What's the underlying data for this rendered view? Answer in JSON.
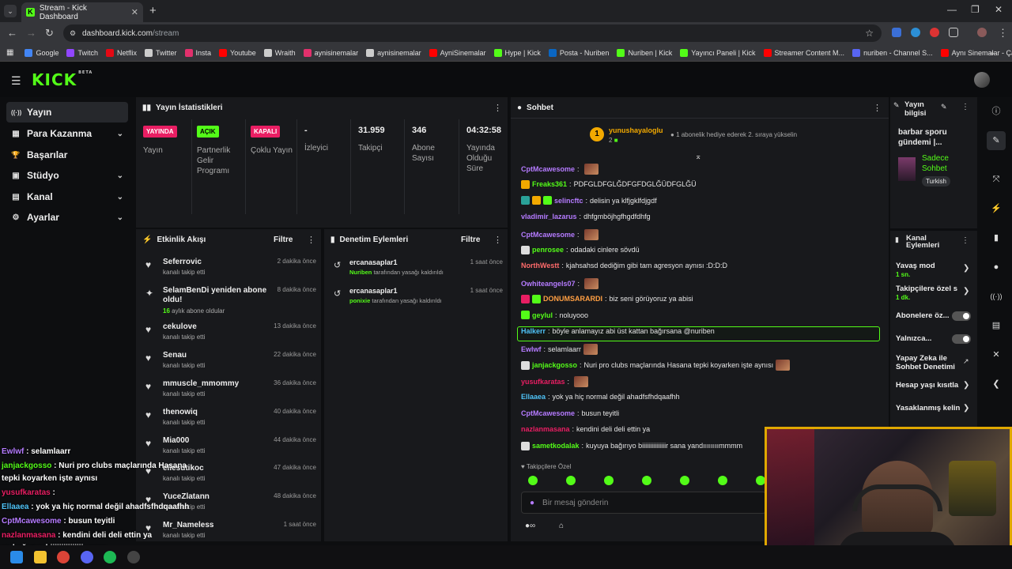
{
  "browser": {
    "tab_title": "Stream - Kick Dashboard",
    "url_host": "dashboard.kick.com",
    "url_path": "/stream",
    "bookmarks": [
      {
        "label": "Google",
        "color": "#4285f4"
      },
      {
        "label": "Twitch",
        "color": "#9146ff"
      },
      {
        "label": "Netflix",
        "color": "#e50914"
      },
      {
        "label": "Twitter",
        "color": "#cccccc"
      },
      {
        "label": "Insta",
        "color": "#e1306c"
      },
      {
        "label": "Youtube",
        "color": "#ff0000"
      },
      {
        "label": "Wraith",
        "color": "#cccccc"
      },
      {
        "label": "aynisinemalar",
        "color": "#e1306c"
      },
      {
        "label": "aynisinemalar",
        "color": "#cccccc"
      },
      {
        "label": "AyniSinemalar",
        "color": "#ff0000"
      },
      {
        "label": "Hype | Kick",
        "color": "#53fc18"
      },
      {
        "label": "Posta - Nuriben",
        "color": "#0a66c2"
      },
      {
        "label": "Nuriben | Kick",
        "color": "#53fc18"
      },
      {
        "label": "Yayıncı Paneli | Kick",
        "color": "#53fc18"
      },
      {
        "label": "Streamer Content M...",
        "color": "#ff0000"
      },
      {
        "label": "nuriben - Channel S...",
        "color": "#5865f2"
      },
      {
        "label": "Aynı Sinemalar - Ça...",
        "color": "#ff0000"
      }
    ],
    "bookmarks_more": "»"
  },
  "header": {
    "logo": "KICK",
    "beta": "BETA"
  },
  "sidebar": {
    "items": [
      {
        "label": "Yayın",
        "icon": "broadcast-icon",
        "glyph": "((·))"
      },
      {
        "label": "Para Kazanma",
        "icon": "money-icon",
        "glyph": "▦",
        "chev": "⌄"
      },
      {
        "label": "Başarılar",
        "icon": "trophy-icon",
        "glyph": "🏆"
      },
      {
        "label": "Stüdyo",
        "icon": "studio-icon",
        "glyph": "▣",
        "chev": "⌄"
      },
      {
        "label": "Kanal",
        "icon": "channel-icon",
        "glyph": "▤",
        "chev": "⌄"
      },
      {
        "label": "Ayarlar",
        "icon": "gear-icon",
        "glyph": "⚙",
        "chev": "⌄"
      }
    ]
  },
  "stats": {
    "title": "Yayın İstatistikleri",
    "items": [
      {
        "badge": "YAYINDA",
        "badge_color": "#e91e63",
        "label": "Yayın"
      },
      {
        "badge": "AÇIK",
        "badge_color": "#53fc18",
        "label": "Partnerlik Gelir Programı"
      },
      {
        "badge": "KAPALI",
        "badge_color": "#e91e63",
        "label": "Çoklu Yayın"
      },
      {
        "value": "-",
        "label": "İzleyici"
      },
      {
        "value": "31.959",
        "label": "Takipçi"
      },
      {
        "value": "346",
        "label": "Abone Sayısı"
      },
      {
        "value": "04:32:58",
        "label": "Yayında Olduğu Süre"
      }
    ]
  },
  "activity": {
    "title": "Etkinlik Akışı",
    "filter": "Filtre",
    "items": [
      {
        "name": "Seferrovic",
        "sub": "kanalı takip etti",
        "time": "2 dakika önce"
      },
      {
        "name": "SelamBenDi yeniden abone oldu!",
        "sub_num": "16",
        "sub": "aylık abone oldular",
        "time": "8 dakika önce"
      },
      {
        "name": "cekulove",
        "sub": "kanalı takip etti",
        "time": "13 dakika önce"
      },
      {
        "name": "Senau",
        "sub": "kanalı takip etti",
        "time": "22 dakika önce"
      },
      {
        "name": "mmuscle_mmommy",
        "sub": "kanalı takip etti",
        "time": "36 dakika önce"
      },
      {
        "name": "thenowiq",
        "sub": "kanalı takip etti",
        "time": "40 dakika önce"
      },
      {
        "name": "Mia000",
        "sub": "kanalı takip etti",
        "time": "44 dakika önce"
      },
      {
        "name": "eliesutikoc",
        "sub": "kanalı takip etti",
        "time": "47 dakika önce"
      },
      {
        "name": "YuceZlatann",
        "sub": "kanalı takip etti",
        "time": "48 dakika önce"
      },
      {
        "name": "Mr_Nameless",
        "sub": "kanalı takip etti",
        "time": "1 saat önce"
      }
    ]
  },
  "moderation": {
    "title": "Denetim Eylemleri",
    "filter": "Filtre",
    "items": [
      {
        "name": "ercanasaplar1",
        "target": "Nuriben",
        "sub": "tarafından yasağı kaldırıldı",
        "time": "1 saat önce"
      },
      {
        "name": "ercanasaplar1",
        "target": "ponixie",
        "sub": "tarafından yasağı kaldırıldı",
        "time": "1 saat önce"
      }
    ]
  },
  "chat": {
    "title": "Sohbet",
    "pinned_user": "yunushayaloglu",
    "pinned_rank": "1",
    "pinned_count": "2",
    "pinned_text": "1 abonelik hediye ederek 2. sıraya yükselin",
    "messages": [
      {
        "user": "CptMcawesome",
        "color": "#b57bff",
        "text": "",
        "emote": true
      },
      {
        "user": "Freaks361",
        "color": "#53fc18",
        "text": "PDFGLDFGLĞDFGFDGLĞÜDFGLĞÜ",
        "badges": [
          "#f2a900"
        ]
      },
      {
        "user": "selincftc",
        "color": "#b57bff",
        "text": "delisin ya klfjgklfdjgdf",
        "badges": [
          "#2aa198",
          "#f2a900",
          "#53fc18"
        ]
      },
      {
        "user": "vladimir_lazarus",
        "color": "#b57bff",
        "text": "dhfgmböjhgfhgdfdhfg"
      },
      {
        "user": "CptMcawesome",
        "color": "#b57bff",
        "text": "",
        "emote": true
      },
      {
        "user": "penrosee",
        "color": "#53fc18",
        "text": "odadaki cinlere sövdü",
        "badges": [
          "#dddddd"
        ]
      },
      {
        "user": "NorthWestt",
        "color": "#ff6b6b",
        "text": "kjahsahsd dediğim gibi tam agresyon aynısı :D:D:D"
      },
      {
        "user": "Owhiteangels07",
        "color": "#b57bff",
        "text": "",
        "emote": true
      },
      {
        "user": "DONUMSARARDI",
        "color": "#ff9f43",
        "text": "biz seni görüyoruz ya abisi",
        "badges": [
          "#e91e63",
          "#53fc18"
        ]
      },
      {
        "user": "geylul",
        "color": "#53fc18",
        "text": "noluyooo",
        "badges": [
          "#53fc18"
        ]
      },
      {
        "user": "Halkerr",
        "color": "#4fc3f7",
        "text": "böyle anlamayız abi üst kattan bağırsana @nuriben"
      },
      {
        "user": "Ewlwf",
        "color": "#b57bff",
        "text": "selamlaarr",
        "emote": true
      },
      {
        "user": "janjackgosso",
        "color": "#53fc18",
        "text": "Nuri pro clubs maçlarında Hasana tepki koyarken işte aynısı",
        "badges": [
          "#dddddd"
        ],
        "emote": true
      },
      {
        "user": "yusufkaratas",
        "color": "#e91e63",
        "text": "",
        "emote": true
      },
      {
        "user": "Ellaaea",
        "color": "#4fc3f7",
        "text": "yok ya hiç normal değil ahadfsfhdqaafhh"
      },
      {
        "user": "CptMcawesome",
        "color": "#b57bff",
        "text": "busun teyitli"
      },
      {
        "user": "nazlanmasana",
        "color": "#e91e63",
        "text": "kendini deli deli ettin ya"
      },
      {
        "user": "sametkodalak",
        "color": "#53fc18",
        "text": "kuyuya bağırıyo biiiiiiiiiiiiiiir sana yandıııııııımmmm",
        "badges": [
          "#dddddd"
        ]
      }
    ],
    "followers_only": "Takipçilere Özel",
    "input_placeholder": "Bir mesaj gönderin"
  },
  "stream_info": {
    "title": "Yayın bilgisi",
    "stream_title": "barbar sporu gündemi |...",
    "chat_mode": "Sadece Sohbet",
    "language": "Turkish"
  },
  "channel_actions": {
    "title": "Kanal Eylemleri",
    "items": [
      {
        "label": "Yavaş mod",
        "value": "1 sn.",
        "type": "arrow"
      },
      {
        "label": "Takipçilere özel s",
        "value": "1 dk.",
        "type": "arrow"
      },
      {
        "label": "Abonelere öz...",
        "type": "toggle"
      },
      {
        "label": "Yalnızca...",
        "type": "toggle"
      },
      {
        "label": "Yapay Zeka ile Sohbet Denetimi",
        "type": "external"
      },
      {
        "label": "Hesap yaşı kısıtla",
        "type": "arrow"
      },
      {
        "label": "Yasaklanmış kelin",
        "type": "arrow"
      }
    ]
  },
  "overlay_chat": [
    {
      "user": "Ewlwf",
      "color": "#b57bff",
      "text": "selamlaarr"
    },
    {
      "user": "janjackgosso",
      "color": "#53fc18",
      "text": "Nuri pro clubs maçlarında Hasana"
    },
    {
      "user": "",
      "color": "#ffffff",
      "text": "tepki koyarken işte aynısı"
    },
    {
      "user": "yusufkaratas",
      "color": "#e91e63",
      "text": ""
    },
    {
      "user": "Ellaaea",
      "color": "#4fc3f7",
      "text": "yok ya hiç normal değil ahadfsfhdqaafhh"
    },
    {
      "user": "CptMcawesome",
      "color": "#b57bff",
      "text": "busun teyitli"
    },
    {
      "user": "nazlanmasana",
      "color": "#e91e63",
      "text": "kendini deli deli ettin ya"
    },
    {
      "user": "",
      "color": "#ffffff",
      "text": "ya bağırıyo biiiiiiiiiiiiiiir sana"
    }
  ],
  "colors": {
    "accent": "#53fc18",
    "live": "#e91e63",
    "panel": "#18191c"
  }
}
